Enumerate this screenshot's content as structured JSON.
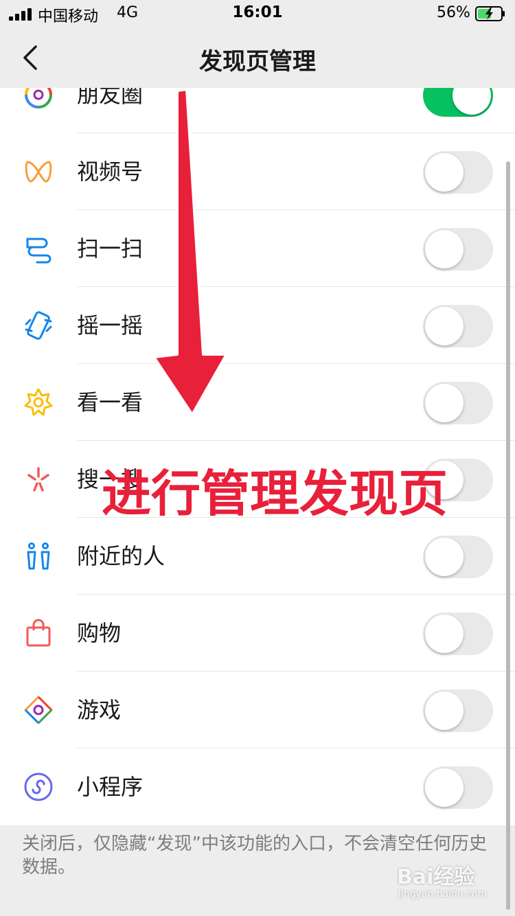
{
  "status_bar": {
    "carrier": "中国移动",
    "network": "4G",
    "time": "16:01",
    "battery": "56%"
  },
  "nav": {
    "title": "发现页管理"
  },
  "items": [
    {
      "label": "朋友圈",
      "icon": "moments-icon",
      "enabled": true
    },
    {
      "label": "视频号",
      "icon": "channels-icon",
      "enabled": false
    },
    {
      "label": "扫一扫",
      "icon": "scan-icon",
      "enabled": false
    },
    {
      "label": "摇一摇",
      "icon": "shake-icon",
      "enabled": false
    },
    {
      "label": "看一看",
      "icon": "top-stories-icon",
      "enabled": false
    },
    {
      "label": "搜一搜",
      "icon": "search-icon",
      "enabled": false
    },
    {
      "label": "附近的人",
      "icon": "people-nearby-icon",
      "enabled": false
    },
    {
      "label": "购物",
      "icon": "shopping-bag-icon",
      "enabled": false
    },
    {
      "label": "游戏",
      "icon": "games-icon",
      "enabled": false
    },
    {
      "label": "小程序",
      "icon": "mini-programs-icon",
      "enabled": false
    }
  ],
  "footer_note": "关闭后，仅隐藏“发现”中该功能的入口，不会清空任何历史数据。",
  "annotation": {
    "text": "进行管理发现页"
  },
  "watermark": {
    "brand": "Bai经验",
    "url": "jingyan.baidu.com"
  },
  "colors": {
    "toggle_on": "#07c160",
    "toggle_off": "#e9e9ea",
    "annotation": "#e8203a"
  }
}
